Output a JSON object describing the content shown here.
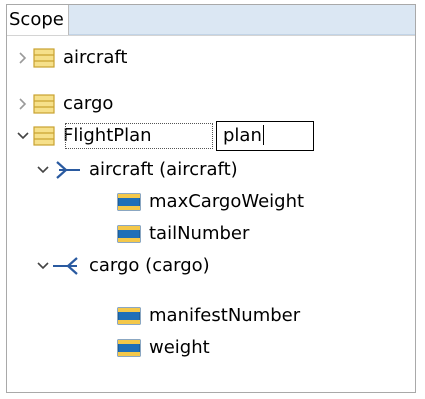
{
  "header": {
    "scope_label": "Scope"
  },
  "tree": {
    "aircraft_label": "aircraft",
    "cargo_label": "cargo",
    "flightplan_label": "FlightPlan",
    "flightplan_edit_value": "plan",
    "ref_aircraft_label": "aircraft (aircraft)",
    "max_cargo_weight_label": "maxCargoWeight",
    "tail_number_label": "tailNumber",
    "ref_cargo_label": "cargo (cargo)",
    "manifest_number_label": "manifestNumber",
    "weight_label": "weight"
  },
  "icons": {
    "collapsed": "chevron-right-icon",
    "expanded": "chevron-down-icon",
    "class": "class-icon",
    "attribute": "attribute-icon",
    "outgoing_reference": "outgoing-reference-icon",
    "incoming_reference": "incoming-reference-icon"
  },
  "colors": {
    "class_fill": "#f6e08a",
    "class_border": "#c9a230",
    "attr_fill": "#1f6fb8",
    "attr_bar": "#f4c84a",
    "header_filler": "#dbe7f3"
  }
}
